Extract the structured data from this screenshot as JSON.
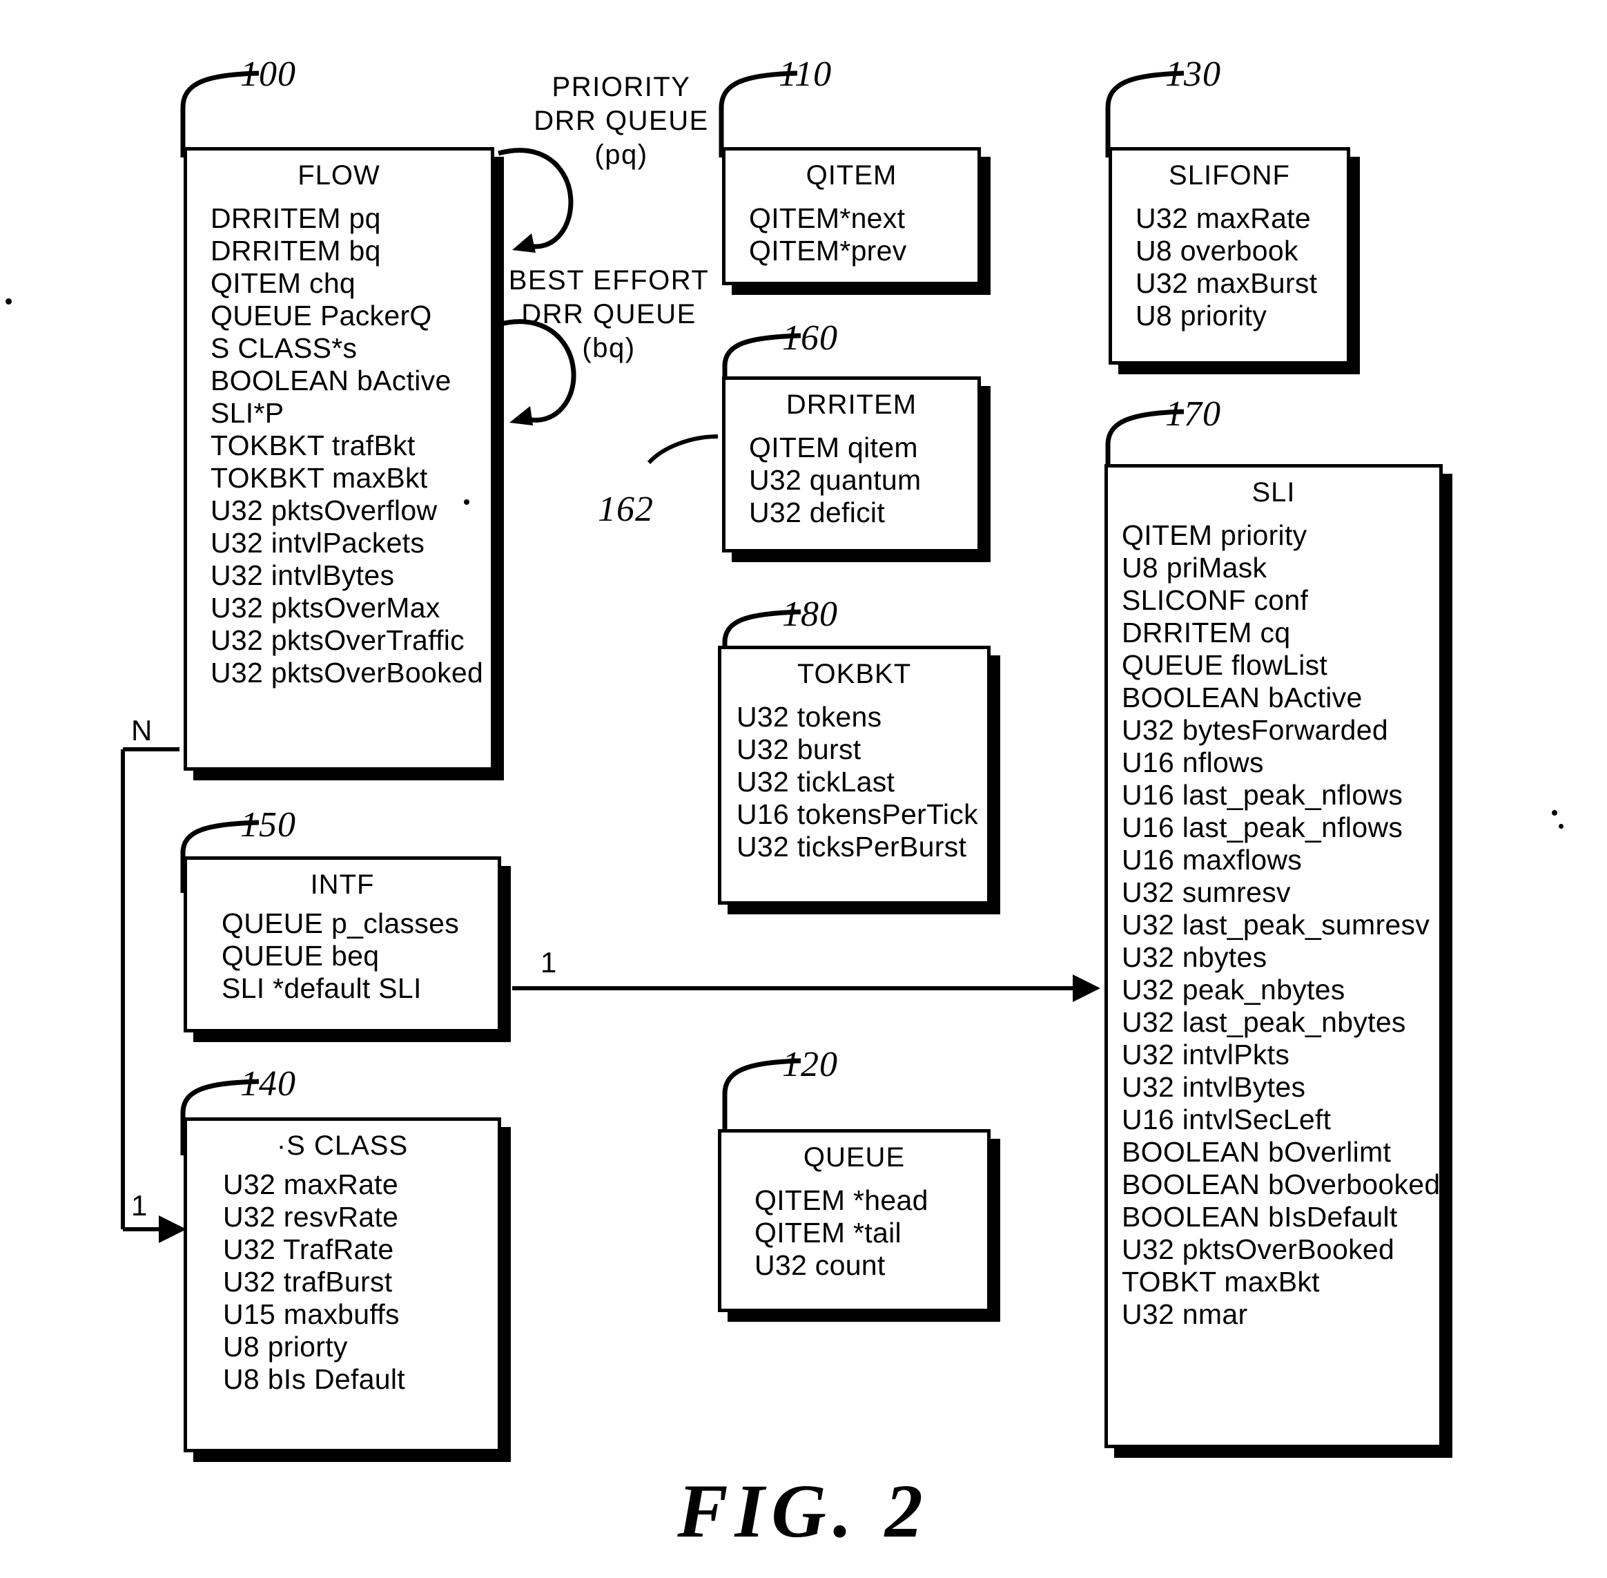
{
  "figure": {
    "caption": "FIG. 2"
  },
  "annotations": {
    "priority_queue_label": [
      "PRIORITY",
      "DRR QUEUE",
      "(pq)"
    ],
    "best_effort_label": [
      "BEST EFFORT",
      "DRR QUEUE",
      "(bq)"
    ],
    "multiplicity_n": "N",
    "multiplicity_one_left": "1",
    "multiplicity_one_intf": "1"
  },
  "boxes": [
    {
      "id": "flow",
      "ref": "100",
      "title": "FLOW",
      "fields": [
        "DRRITEM pq",
        "DRRITEM bq",
        "QITEM chq",
        "QUEUE PackerQ",
        "S CLASS*s",
        "BOOLEAN bActive",
        "SLI*P",
        "TOKBKT  trafBkt",
        "TOKBKT  maxBkt",
        "U32 pktsOverflow",
        "U32 intvlPackets",
        "U32 intvlBytes",
        "U32 pktsOverMax",
        "U32 pktsOverTraffic",
        "U32 pktsOverBooked"
      ]
    },
    {
      "id": "qitem",
      "ref": "110",
      "title": "QITEM",
      "fields": [
        "QITEM*next",
        "QITEM*prev"
      ]
    },
    {
      "id": "sliconf",
      "ref": "130",
      "title": "SLIFONF",
      "fields": [
        "U32 maxRate",
        "U8 overbook",
        "U32 maxBurst",
        "U8 priority"
      ]
    },
    {
      "id": "drritem",
      "ref": "160",
      "subref": "162",
      "title": "DRRITEM",
      "fields": [
        "QITEM qitem",
        "U32 quantum",
        "U32 deficit"
      ]
    },
    {
      "id": "sli",
      "ref": "170",
      "title": "SLI",
      "fields": [
        "QITEM priority",
        "U8 priMask",
        "SLICONF conf",
        "DRRITEM cq",
        "QUEUE flowList",
        "BOOLEAN bActive",
        "U32 bytesForwarded",
        "U16 nflows",
        "U16 last_peak_nflows",
        "U16 last_peak_nflows",
        "U16 maxflows",
        "U32 sumresv",
        "U32 last_peak_sumresv",
        "U32 nbytes",
        "U32 peak_nbytes",
        "U32 last_peak_nbytes",
        "U32 intvlPkts",
        "U32 intvlBytes",
        "U16 intvlSecLeft",
        "BOOLEAN bOverlimt",
        "BOOLEAN bOverbooked",
        "BOOLEAN bIsDefault",
        "U32 pktsOverBooked",
        "TOBKT maxBkt",
        "U32 nmar"
      ]
    },
    {
      "id": "tokbkt",
      "ref": "180",
      "title": "TOKBKT",
      "fields": [
        "U32 tokens",
        "U32 burst",
        "U32 tickLast",
        "U16 tokensPerTick",
        "U32 ticksPerBurst"
      ]
    },
    {
      "id": "intf",
      "ref": "150",
      "title": "INTF",
      "fields": [
        "QUEUE p_classes",
        "QUEUE beq",
        "SLI *default SLI"
      ]
    },
    {
      "id": "sclass",
      "ref": "140",
      "title": "·S CLASS",
      "fields": [
        "U32 maxRate",
        "U32 resvRate",
        "U32 TrafRate",
        "U32 trafBurst",
        "U15 maxbuffs",
        "U8 priorty",
        "U8 bIs Default"
      ]
    },
    {
      "id": "queue",
      "ref": "120",
      "title": "QUEUE",
      "fields": [
        "QITEM *head",
        "QITEM *tail",
        "U32 count"
      ]
    }
  ]
}
